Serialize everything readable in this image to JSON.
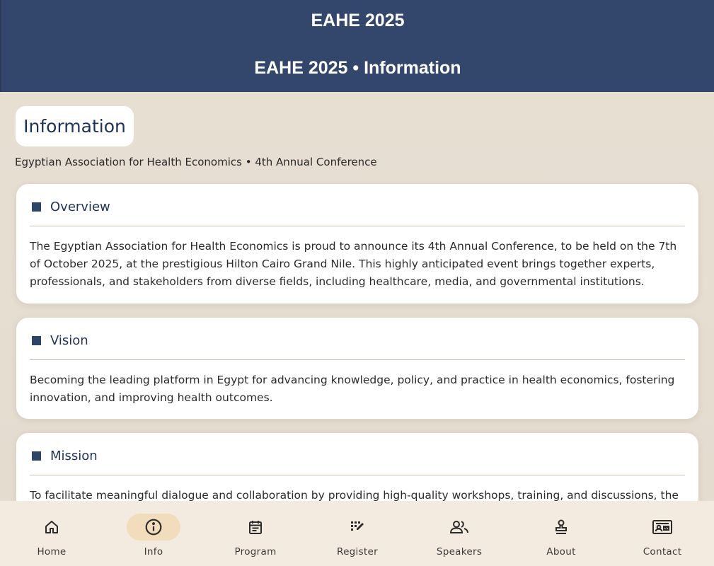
{
  "header": {
    "app_title": "EAHE 2025",
    "page_heading": "EAHE 2025 • Information"
  },
  "main": {
    "section_title": "Information",
    "subtitle": "Egyptian Association for Health Economics • 4th Annual Conference",
    "cards": [
      {
        "title": "Overview",
        "icon": "square-bullet-icon",
        "body": "The Egyptian Association for Health Economics is proud to announce its 4th Annual Conference, to be held on the 7th of October 2025, at the prestigious Hilton Cairo Grand Nile. This highly anticipated event brings together experts, professionals, and stakeholders from diverse fields, including healthcare, media, and governmental institutions."
      },
      {
        "title": "Vision",
        "icon": "square-bullet-icon",
        "body": "Becoming the leading platform in Egypt for advancing knowledge, policy, and practice in health economics, fostering innovation, and improving health outcomes."
      },
      {
        "title": "Mission",
        "icon": "square-bullet-icon",
        "body": "To facilitate meaningful dialogue and collaboration by providing high-quality workshops, training, and discussions, the"
      }
    ]
  },
  "nav": {
    "active": "Info",
    "items": [
      {
        "label": "Home",
        "icon": "home-icon"
      },
      {
        "label": "Info",
        "icon": "info-icon"
      },
      {
        "label": "Program",
        "icon": "calendar-icon"
      },
      {
        "label": "Register",
        "icon": "register-icon"
      },
      {
        "label": "Speakers",
        "icon": "people-icon"
      },
      {
        "label": "About",
        "icon": "stamp-icon"
      },
      {
        "label": "Contact",
        "icon": "contact-card-icon"
      }
    ]
  },
  "colors": {
    "header_bg": "#33466b",
    "accent": "#1f3358",
    "page_bg": "#e8e0d4",
    "nav_bg": "#f3ebe0",
    "nav_active_pill": "#f1dcbc"
  }
}
